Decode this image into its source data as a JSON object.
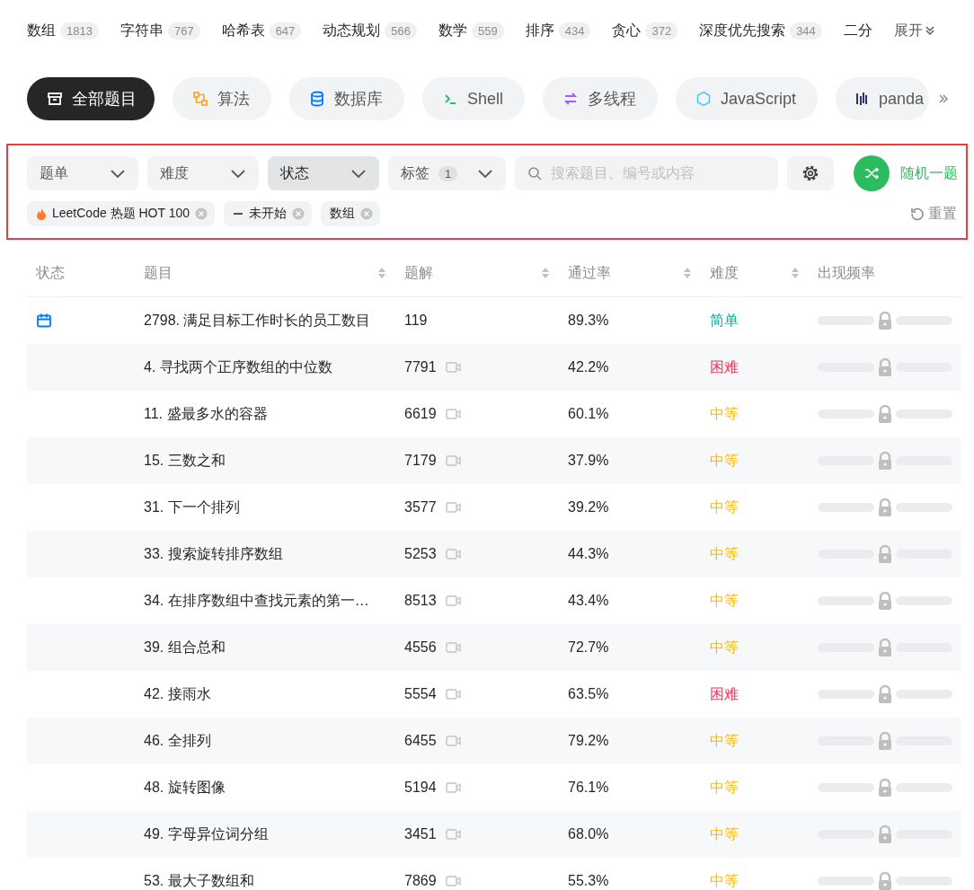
{
  "topic_tags": [
    {
      "label": "数组",
      "count": "1813"
    },
    {
      "label": "字符串",
      "count": "767"
    },
    {
      "label": "哈希表",
      "count": "647"
    },
    {
      "label": "动态规划",
      "count": "566"
    },
    {
      "label": "数学",
      "count": "559"
    },
    {
      "label": "排序",
      "count": "434"
    },
    {
      "label": "贪心",
      "count": "372"
    },
    {
      "label": "深度优先搜索",
      "count": "344"
    },
    {
      "label": "二分"
    }
  ],
  "expand_label": "展开",
  "categories": [
    {
      "label": "全部题目",
      "kind": "all",
      "selected": true
    },
    {
      "label": "算法",
      "kind": "algorithm",
      "selected": false
    },
    {
      "label": "数据库",
      "kind": "database",
      "selected": false
    },
    {
      "label": "Shell",
      "kind": "shell",
      "selected": false
    },
    {
      "label": "多线程",
      "kind": "thread",
      "selected": false
    },
    {
      "label": "JavaScript",
      "kind": "js",
      "selected": false
    },
    {
      "label": "panda",
      "kind": "pandas",
      "selected": false
    }
  ],
  "filters": {
    "dropdowns": [
      {
        "label": "题单",
        "selected": false
      },
      {
        "label": "难度",
        "selected": false
      },
      {
        "label": "状态",
        "selected": true
      },
      {
        "label": "标签",
        "badge": "1",
        "selected": false
      }
    ],
    "search": {
      "placeholder": "搜索题目、编号或内容"
    },
    "random_button": "随机一题",
    "active_filters": [
      {
        "label": "LeetCode 热题 HOT 100",
        "kind": "hot"
      },
      {
        "label": "未开始",
        "kind": "status"
      },
      {
        "label": "数组",
        "kind": "plain"
      }
    ],
    "reset": "重置"
  },
  "table": {
    "columns": [
      {
        "label": "状态",
        "sortable": false
      },
      {
        "label": "题目",
        "sortable": true
      },
      {
        "label": "题解",
        "sortable": true
      },
      {
        "label": "通过率",
        "sortable": true
      },
      {
        "label": "难度",
        "sortable": true
      },
      {
        "label": "出现频率",
        "sortable": false
      }
    ],
    "rows": [
      {
        "daily": true,
        "title": "2798. 满足目标工作时长的员工数目",
        "solutions": "119",
        "video": false,
        "acceptance": "89.3%",
        "difficulty": "简单",
        "color": "#00af9b"
      },
      {
        "daily": false,
        "title": "4. 寻找两个正序数组的中位数",
        "solutions": "7791",
        "video": true,
        "acceptance": "42.2%",
        "difficulty": "困难",
        "color": "#ff2d55"
      },
      {
        "daily": false,
        "title": "11. 盛最多水的容器",
        "solutions": "6619",
        "video": true,
        "acceptance": "60.1%",
        "difficulty": "中等",
        "color": "#ffb800"
      },
      {
        "daily": false,
        "title": "15. 三数之和",
        "solutions": "7179",
        "video": true,
        "acceptance": "37.9%",
        "difficulty": "中等",
        "color": "#ffb800"
      },
      {
        "daily": false,
        "title": "31. 下一个排列",
        "solutions": "3577",
        "video": true,
        "acceptance": "39.2%",
        "difficulty": "中等",
        "color": "#ffb800"
      },
      {
        "daily": false,
        "title": "33. 搜索旋转排序数组",
        "solutions": "5253",
        "video": true,
        "acceptance": "44.3%",
        "difficulty": "中等",
        "color": "#ffb800"
      },
      {
        "daily": false,
        "title": "34. 在排序数组中查找元素的第一…",
        "solutions": "8513",
        "video": true,
        "acceptance": "43.4%",
        "difficulty": "中等",
        "color": "#ffb800"
      },
      {
        "daily": false,
        "title": "39. 组合总和",
        "solutions": "4556",
        "video": true,
        "acceptance": "72.7%",
        "difficulty": "中等",
        "color": "#ffb800"
      },
      {
        "daily": false,
        "title": "42. 接雨水",
        "solutions": "5554",
        "video": true,
        "acceptance": "63.5%",
        "difficulty": "困难",
        "color": "#ff2d55"
      },
      {
        "daily": false,
        "title": "46. 全排列",
        "solutions": "6455",
        "video": true,
        "acceptance": "79.2%",
        "difficulty": "中等",
        "color": "#ffb800"
      },
      {
        "daily": false,
        "title": "48. 旋转图像",
        "solutions": "5194",
        "video": true,
        "acceptance": "76.1%",
        "difficulty": "中等",
        "color": "#ffb800"
      },
      {
        "daily": false,
        "title": "49. 字母异位词分组",
        "solutions": "3451",
        "video": true,
        "acceptance": "68.0%",
        "difficulty": "中等",
        "color": "#ffb800"
      },
      {
        "daily": false,
        "title": "53. 最大子数组和",
        "solutions": "7869",
        "video": true,
        "acceptance": "55.3%",
        "difficulty": "中等",
        "color": "#ffb800"
      }
    ]
  }
}
